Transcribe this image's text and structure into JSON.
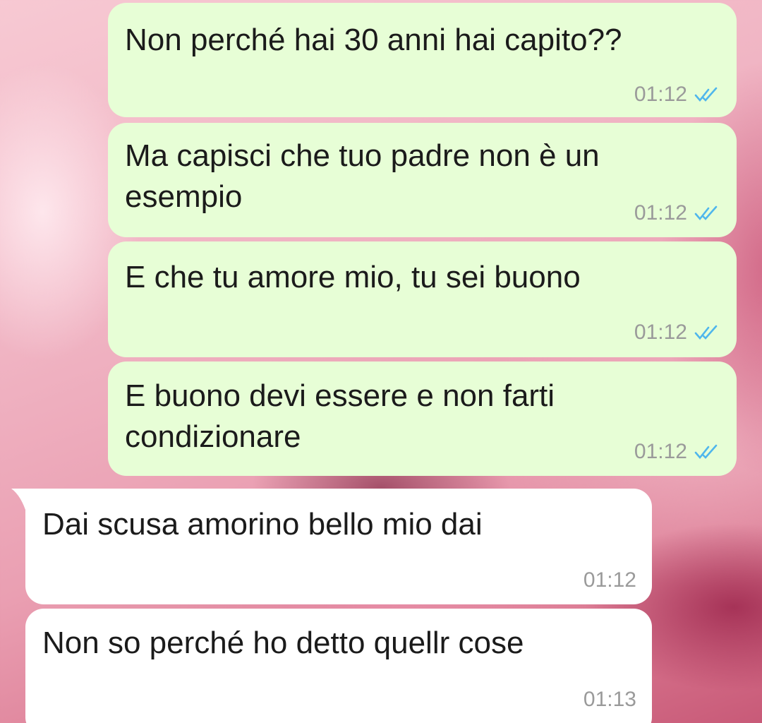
{
  "chat": {
    "messages": [
      {
        "direction": "outgoing",
        "text": "Non perché hai 30 anni hai capito??",
        "time": "01:12",
        "status_icon": "double-check-read-icon"
      },
      {
        "direction": "outgoing",
        "text": "Ma capisci che tuo padre non è un\nesempio",
        "time": "01:12",
        "status_icon": "double-check-read-icon"
      },
      {
        "direction": "outgoing",
        "text": "E che tu amore mio, tu sei buono",
        "time": "01:12",
        "status_icon": "double-check-read-icon"
      },
      {
        "direction": "outgoing",
        "text": "E buono devi essere e non farti\ncondizionare",
        "time": "01:12",
        "status_icon": "double-check-read-icon"
      },
      {
        "direction": "incoming",
        "text": "Dai scusa amorino bello mio dai",
        "time": "01:12"
      },
      {
        "direction": "incoming",
        "text": "Non so perché ho detto quellr cose",
        "time": "01:13"
      }
    ]
  },
  "colors": {
    "outgoing_bubble": "#e7fed6",
    "incoming_bubble": "#ffffff",
    "read_tick": "#4fb6ec",
    "timestamp": "#9a9a9a"
  }
}
